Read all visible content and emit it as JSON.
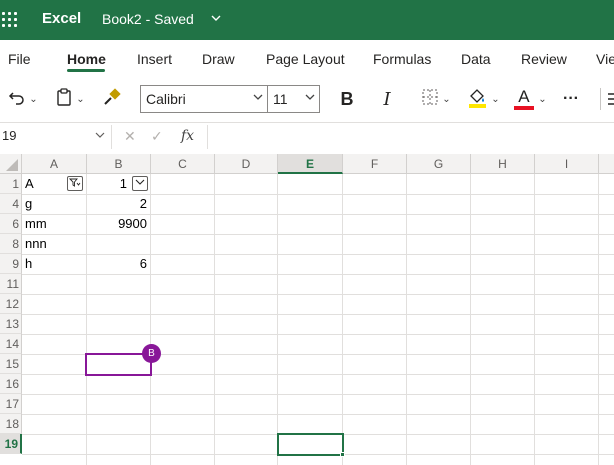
{
  "app": {
    "name": "Excel",
    "document": "Book2 - Saved"
  },
  "tabs": [
    "File",
    "Home",
    "Insert",
    "Draw",
    "Page Layout",
    "Formulas",
    "Data",
    "Review",
    "Vie"
  ],
  "toolbar": {
    "font_name": "Calibri",
    "font_size": "11",
    "bold": "B",
    "italic": "I",
    "text_color_letter": "A",
    "more": "···"
  },
  "formula_bar": {
    "name_box": "19",
    "fx": "fx",
    "cancel": "✕",
    "enter": "✓",
    "formula": ""
  },
  "columns": [
    "A",
    "B",
    "C",
    "D",
    "E",
    "F",
    "G",
    "H",
    "I"
  ],
  "selected_column": "E",
  "rows": [
    "1",
    "4",
    "6",
    "8",
    "9",
    "11",
    "12",
    "13",
    "14",
    "15",
    "16",
    "17",
    "18",
    "19"
  ],
  "selected_row": "19",
  "cells": {
    "r1": {
      "A": "A",
      "B": "1"
    },
    "r4": {
      "A": "g",
      "B": "2"
    },
    "r6": {
      "A": "mm",
      "B": "9900"
    },
    "r8": {
      "A": "nnn",
      "B": ""
    },
    "r9": {
      "A": "h",
      "B": "6"
    }
  },
  "collaborator": {
    "initial": "B",
    "color": "#881798"
  },
  "colors": {
    "brand": "#217346",
    "highlight": "#FFE600",
    "font_color": "#E81123"
  }
}
